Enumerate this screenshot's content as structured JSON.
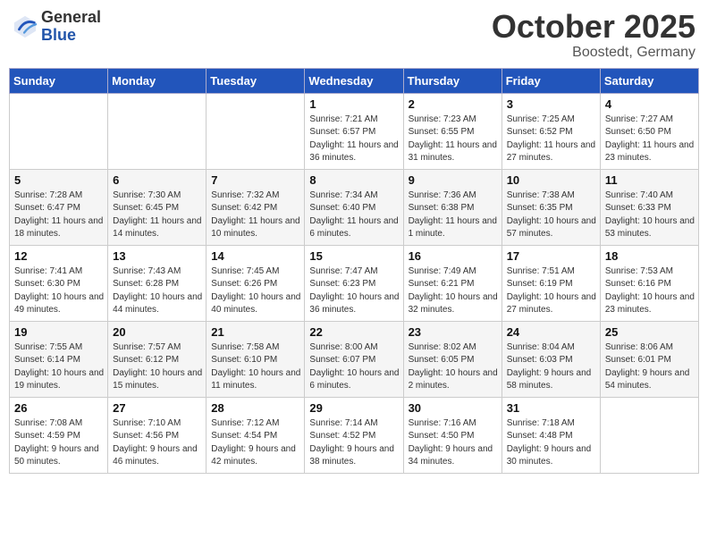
{
  "header": {
    "logo_general": "General",
    "logo_blue": "Blue",
    "month_title": "October 2025",
    "location": "Boostedt, Germany"
  },
  "days_of_week": [
    "Sunday",
    "Monday",
    "Tuesday",
    "Wednesday",
    "Thursday",
    "Friday",
    "Saturday"
  ],
  "weeks": [
    [
      {
        "day": "",
        "sunrise": "",
        "sunset": "",
        "daylight": ""
      },
      {
        "day": "",
        "sunrise": "",
        "sunset": "",
        "daylight": ""
      },
      {
        "day": "",
        "sunrise": "",
        "sunset": "",
        "daylight": ""
      },
      {
        "day": "1",
        "sunrise": "Sunrise: 7:21 AM",
        "sunset": "Sunset: 6:57 PM",
        "daylight": "Daylight: 11 hours and 36 minutes."
      },
      {
        "day": "2",
        "sunrise": "Sunrise: 7:23 AM",
        "sunset": "Sunset: 6:55 PM",
        "daylight": "Daylight: 11 hours and 31 minutes."
      },
      {
        "day": "3",
        "sunrise": "Sunrise: 7:25 AM",
        "sunset": "Sunset: 6:52 PM",
        "daylight": "Daylight: 11 hours and 27 minutes."
      },
      {
        "day": "4",
        "sunrise": "Sunrise: 7:27 AM",
        "sunset": "Sunset: 6:50 PM",
        "daylight": "Daylight: 11 hours and 23 minutes."
      }
    ],
    [
      {
        "day": "5",
        "sunrise": "Sunrise: 7:28 AM",
        "sunset": "Sunset: 6:47 PM",
        "daylight": "Daylight: 11 hours and 18 minutes."
      },
      {
        "day": "6",
        "sunrise": "Sunrise: 7:30 AM",
        "sunset": "Sunset: 6:45 PM",
        "daylight": "Daylight: 11 hours and 14 minutes."
      },
      {
        "day": "7",
        "sunrise": "Sunrise: 7:32 AM",
        "sunset": "Sunset: 6:42 PM",
        "daylight": "Daylight: 11 hours and 10 minutes."
      },
      {
        "day": "8",
        "sunrise": "Sunrise: 7:34 AM",
        "sunset": "Sunset: 6:40 PM",
        "daylight": "Daylight: 11 hours and 6 minutes."
      },
      {
        "day": "9",
        "sunrise": "Sunrise: 7:36 AM",
        "sunset": "Sunset: 6:38 PM",
        "daylight": "Daylight: 11 hours and 1 minute."
      },
      {
        "day": "10",
        "sunrise": "Sunrise: 7:38 AM",
        "sunset": "Sunset: 6:35 PM",
        "daylight": "Daylight: 10 hours and 57 minutes."
      },
      {
        "day": "11",
        "sunrise": "Sunrise: 7:40 AM",
        "sunset": "Sunset: 6:33 PM",
        "daylight": "Daylight: 10 hours and 53 minutes."
      }
    ],
    [
      {
        "day": "12",
        "sunrise": "Sunrise: 7:41 AM",
        "sunset": "Sunset: 6:30 PM",
        "daylight": "Daylight: 10 hours and 49 minutes."
      },
      {
        "day": "13",
        "sunrise": "Sunrise: 7:43 AM",
        "sunset": "Sunset: 6:28 PM",
        "daylight": "Daylight: 10 hours and 44 minutes."
      },
      {
        "day": "14",
        "sunrise": "Sunrise: 7:45 AM",
        "sunset": "Sunset: 6:26 PM",
        "daylight": "Daylight: 10 hours and 40 minutes."
      },
      {
        "day": "15",
        "sunrise": "Sunrise: 7:47 AM",
        "sunset": "Sunset: 6:23 PM",
        "daylight": "Daylight: 10 hours and 36 minutes."
      },
      {
        "day": "16",
        "sunrise": "Sunrise: 7:49 AM",
        "sunset": "Sunset: 6:21 PM",
        "daylight": "Daylight: 10 hours and 32 minutes."
      },
      {
        "day": "17",
        "sunrise": "Sunrise: 7:51 AM",
        "sunset": "Sunset: 6:19 PM",
        "daylight": "Daylight: 10 hours and 27 minutes."
      },
      {
        "day": "18",
        "sunrise": "Sunrise: 7:53 AM",
        "sunset": "Sunset: 6:16 PM",
        "daylight": "Daylight: 10 hours and 23 minutes."
      }
    ],
    [
      {
        "day": "19",
        "sunrise": "Sunrise: 7:55 AM",
        "sunset": "Sunset: 6:14 PM",
        "daylight": "Daylight: 10 hours and 19 minutes."
      },
      {
        "day": "20",
        "sunrise": "Sunrise: 7:57 AM",
        "sunset": "Sunset: 6:12 PM",
        "daylight": "Daylight: 10 hours and 15 minutes."
      },
      {
        "day": "21",
        "sunrise": "Sunrise: 7:58 AM",
        "sunset": "Sunset: 6:10 PM",
        "daylight": "Daylight: 10 hours and 11 minutes."
      },
      {
        "day": "22",
        "sunrise": "Sunrise: 8:00 AM",
        "sunset": "Sunset: 6:07 PM",
        "daylight": "Daylight: 10 hours and 6 minutes."
      },
      {
        "day": "23",
        "sunrise": "Sunrise: 8:02 AM",
        "sunset": "Sunset: 6:05 PM",
        "daylight": "Daylight: 10 hours and 2 minutes."
      },
      {
        "day": "24",
        "sunrise": "Sunrise: 8:04 AM",
        "sunset": "Sunset: 6:03 PM",
        "daylight": "Daylight: 9 hours and 58 minutes."
      },
      {
        "day": "25",
        "sunrise": "Sunrise: 8:06 AM",
        "sunset": "Sunset: 6:01 PM",
        "daylight": "Daylight: 9 hours and 54 minutes."
      }
    ],
    [
      {
        "day": "26",
        "sunrise": "Sunrise: 7:08 AM",
        "sunset": "Sunset: 4:59 PM",
        "daylight": "Daylight: 9 hours and 50 minutes."
      },
      {
        "day": "27",
        "sunrise": "Sunrise: 7:10 AM",
        "sunset": "Sunset: 4:56 PM",
        "daylight": "Daylight: 9 hours and 46 minutes."
      },
      {
        "day": "28",
        "sunrise": "Sunrise: 7:12 AM",
        "sunset": "Sunset: 4:54 PM",
        "daylight": "Daylight: 9 hours and 42 minutes."
      },
      {
        "day": "29",
        "sunrise": "Sunrise: 7:14 AM",
        "sunset": "Sunset: 4:52 PM",
        "daylight": "Daylight: 9 hours and 38 minutes."
      },
      {
        "day": "30",
        "sunrise": "Sunrise: 7:16 AM",
        "sunset": "Sunset: 4:50 PM",
        "daylight": "Daylight: 9 hours and 34 minutes."
      },
      {
        "day": "31",
        "sunrise": "Sunrise: 7:18 AM",
        "sunset": "Sunset: 4:48 PM",
        "daylight": "Daylight: 9 hours and 30 minutes."
      },
      {
        "day": "",
        "sunrise": "",
        "sunset": "",
        "daylight": ""
      }
    ]
  ]
}
